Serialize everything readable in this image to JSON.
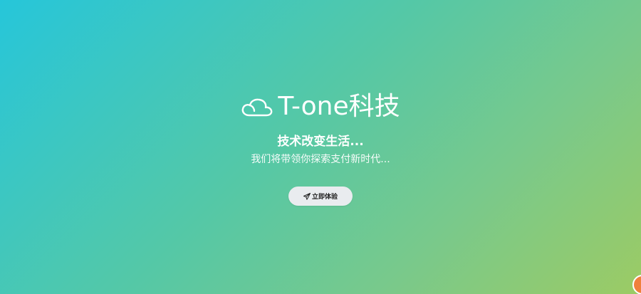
{
  "hero": {
    "brand_latin": "T-one",
    "brand_cn": "科技",
    "tagline": "技术改变生活...",
    "subline": "我们将带领你探索支付新时代...",
    "cta_label": "立即体验"
  },
  "icons": {
    "logo": "cloud-outline-icon",
    "cta": "paper-plane-icon",
    "corner": "floating-chat-badge-icon"
  },
  "colors": {
    "gradient_start": "#26c6da",
    "gradient_end": "#9ccb64",
    "button_bg": "#e9ecef",
    "badge": "#f0803c"
  }
}
